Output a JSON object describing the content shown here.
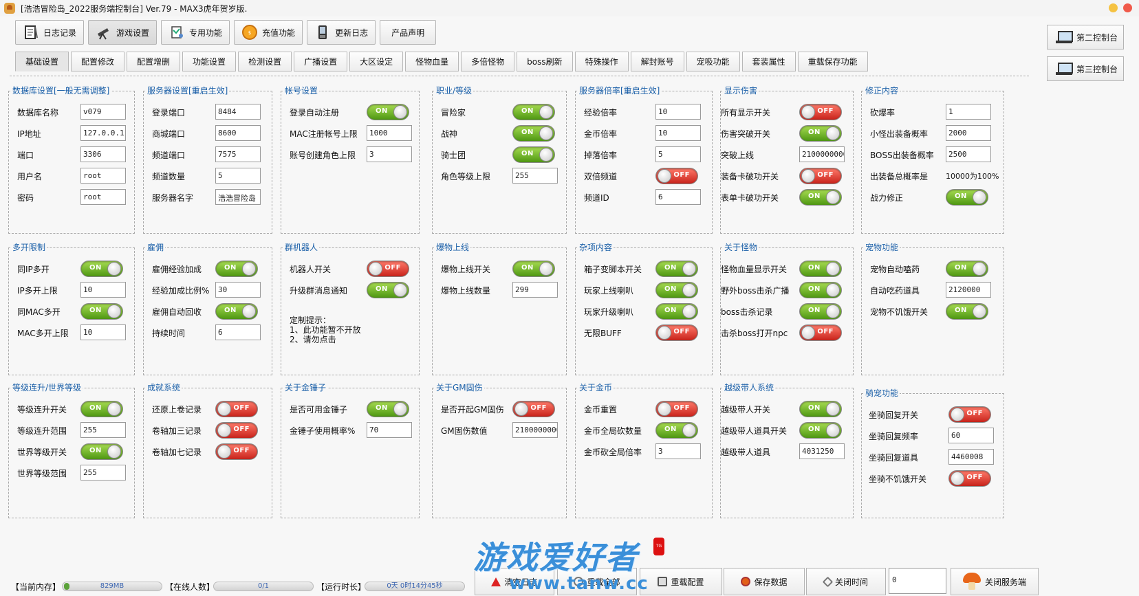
{
  "window": {
    "title": "[浩浩冒险岛_2022服务端控制台] Ver.79 - MAX3虎年贺岁版."
  },
  "main_tabs": [
    {
      "label": "日志记录",
      "icon": "log-icon"
    },
    {
      "label": "游戏设置",
      "icon": "telescope-icon"
    },
    {
      "label": "专用功能",
      "icon": "scroll-icon"
    },
    {
      "label": "充值功能",
      "icon": "coin-icon"
    },
    {
      "label": "更新日志",
      "icon": "phone-icon"
    },
    {
      "label": "产品声明",
      "icon": ""
    }
  ],
  "side_buttons": [
    "第二控制台",
    "第三控制台"
  ],
  "sub_tabs": [
    "基础设置",
    "配置修改",
    "配置增删",
    "功能设置",
    "检测设置",
    "广播设置",
    "大区设定",
    "怪物血量",
    "多倍怪物",
    "boss刷新",
    "特殊操作",
    "解封账号",
    "宠吸功能",
    "套装属性",
    "重载保存功能"
  ],
  "groups": [
    {
      "title": "数据库设置[一般无需调整]",
      "rows": [
        {
          "label": "数据库名称",
          "type": "text",
          "value": "v079"
        },
        {
          "label": "IP地址",
          "type": "text",
          "value": "127.0.0.1"
        },
        {
          "label": "端口",
          "type": "text",
          "value": "3306"
        },
        {
          "label": "用户名",
          "type": "text",
          "value": "root"
        },
        {
          "label": "密码",
          "type": "text",
          "value": "root"
        }
      ]
    },
    {
      "title": "服务器设置[重启生效]",
      "rows": [
        {
          "label": "登录端口",
          "type": "text",
          "value": "8484"
        },
        {
          "label": "商城端口",
          "type": "text",
          "value": "8600"
        },
        {
          "label": "频道端口",
          "type": "text",
          "value": "7575"
        },
        {
          "label": "频道数量",
          "type": "text",
          "value": "5"
        },
        {
          "label": "服务器名字",
          "type": "text",
          "value": "浩浩冒险岛"
        }
      ]
    },
    {
      "title": "帐号设置",
      "rows": [
        {
          "label": "登录自动注册",
          "type": "toggle",
          "value": "ON"
        },
        {
          "label": "MAC注册帐号上限",
          "type": "text",
          "value": "1000"
        },
        {
          "label": "账号创建角色上限",
          "type": "text",
          "value": "3"
        }
      ]
    },
    {
      "title": "职业/等级",
      "rows": [
        {
          "label": "冒险家",
          "type": "toggle",
          "value": "ON"
        },
        {
          "label": "战神",
          "type": "toggle",
          "value": "ON"
        },
        {
          "label": "骑士团",
          "type": "toggle",
          "value": "ON"
        },
        {
          "label": "角色等级上限",
          "type": "text",
          "value": "255"
        }
      ]
    },
    {
      "title": "服务器倍率[重启生效]",
      "rows": [
        {
          "label": "经验倍率",
          "type": "text",
          "value": "10"
        },
        {
          "label": "金币倍率",
          "type": "text",
          "value": "10"
        },
        {
          "label": "掉落倍率",
          "type": "text",
          "value": "5"
        },
        {
          "label": "双倍频道",
          "type": "toggle",
          "value": "OFF"
        },
        {
          "label": "频道ID",
          "type": "text",
          "value": "6"
        }
      ]
    },
    {
      "title": "显示伤害",
      "rows": [
        {
          "label": "所有显示开关",
          "type": "toggle",
          "value": "OFF"
        },
        {
          "label": "伤害突破开关",
          "type": "toggle",
          "value": "ON"
        },
        {
          "label": "突破上线",
          "type": "text",
          "value": "2100000000"
        },
        {
          "label": "装备卡破功开关",
          "type": "toggle",
          "value": "OFF"
        },
        {
          "label": "表单卡破功开关",
          "type": "toggle",
          "value": "ON"
        }
      ]
    },
    {
      "title": "修正内容",
      "rows": [
        {
          "label": "砍爆率",
          "type": "text",
          "value": "1"
        },
        {
          "label": "小怪出装备概率",
          "type": "text",
          "value": "2000"
        },
        {
          "label": "BOSS出装备概率",
          "type": "text",
          "value": "2500"
        },
        {
          "label": "出装备总概率是",
          "type": "static",
          "value": "10000为100%"
        },
        {
          "label": "战力修正",
          "type": "toggle",
          "value": "ON"
        }
      ]
    },
    {
      "title": "多开限制",
      "rows": [
        {
          "label": "同IP多开",
          "type": "toggle",
          "value": "ON"
        },
        {
          "label": "IP多开上限",
          "type": "text",
          "value": "10"
        },
        {
          "label": "同MAC多开",
          "type": "toggle",
          "value": "ON"
        },
        {
          "label": "MAC多开上限",
          "type": "text",
          "value": "10"
        }
      ]
    },
    {
      "title": "雇佣",
      "rows": [
        {
          "label": "雇佣经验加成",
          "type": "toggle",
          "value": "ON"
        },
        {
          "label": "经验加成比例%",
          "type": "text",
          "value": "30"
        },
        {
          "label": "雇佣自动回收",
          "type": "toggle",
          "value": "ON"
        },
        {
          "label": "持续时间",
          "type": "text",
          "value": "6"
        }
      ]
    },
    {
      "title": "群机器人",
      "rows": [
        {
          "label": "机器人开关",
          "type": "toggle",
          "value": "OFF"
        },
        {
          "label": "升级群消息通知",
          "type": "toggle",
          "value": "ON"
        }
      ],
      "note": "定制提示：\n1、此功能暂不开放\n2、请勿点击"
    },
    {
      "title": "爆物上线",
      "rows": [
        {
          "label": "爆物上线开关",
          "type": "toggle",
          "value": "ON"
        },
        {
          "label": "爆物上线数量",
          "type": "text",
          "value": "299"
        }
      ]
    },
    {
      "title": "杂项内容",
      "rows": [
        {
          "label": "箱子变脚本开关",
          "type": "toggle",
          "value": "ON"
        },
        {
          "label": "玩家上线喇叭",
          "type": "toggle",
          "value": "ON"
        },
        {
          "label": "玩家升级喇叭",
          "type": "toggle",
          "value": "ON"
        },
        {
          "label": "无限BUFF",
          "type": "toggle",
          "value": "OFF"
        }
      ]
    },
    {
      "title": "关于怪物",
      "rows": [
        {
          "label": "怪物血量显示开关",
          "type": "toggle",
          "value": "ON"
        },
        {
          "label": "野外boss击杀广播",
          "type": "toggle",
          "value": "ON"
        },
        {
          "label": "boss击杀记录",
          "type": "toggle",
          "value": "ON"
        },
        {
          "label": "击杀boss打开npc",
          "type": "toggle",
          "value": "OFF"
        }
      ]
    },
    {
      "title": "宠物功能",
      "rows": [
        {
          "label": "宠物自动嗑药",
          "type": "toggle",
          "value": "ON"
        },
        {
          "label": "自动吃药道具",
          "type": "text",
          "value": "2120000"
        },
        {
          "label": "宠物不饥饿开关",
          "type": "toggle",
          "value": "ON"
        }
      ]
    },
    {
      "title": "等级连升/世界等级",
      "rows": [
        {
          "label": "等级连升开关",
          "type": "toggle",
          "value": "ON"
        },
        {
          "label": "等级连升范围",
          "type": "text",
          "value": "255"
        },
        {
          "label": "世界等级开关",
          "type": "toggle",
          "value": "ON"
        },
        {
          "label": "世界等级范围",
          "type": "text",
          "value": "255"
        }
      ]
    },
    {
      "title": "成就系统",
      "rows": [
        {
          "label": "还原上卷记录",
          "type": "toggle",
          "value": "OFF"
        },
        {
          "label": "卷轴加三记录",
          "type": "toggle",
          "value": "OFF"
        },
        {
          "label": "卷轴加七记录",
          "type": "toggle",
          "value": "OFF"
        }
      ]
    },
    {
      "title": "关于金锤子",
      "rows": [
        {
          "label": "是否可用金锤子",
          "type": "toggle",
          "value": "ON"
        },
        {
          "label": "金锤子使用概率%",
          "type": "text",
          "value": "70"
        }
      ]
    },
    {
      "title": "关于GM固伤",
      "rows": [
        {
          "label": "是否开起GM固伤",
          "type": "toggle",
          "value": "OFF"
        },
        {
          "label": "GM固伤数值",
          "type": "text",
          "value": "2100000000"
        }
      ]
    },
    {
      "title": "关于金币",
      "rows": [
        {
          "label": "金币重置",
          "type": "toggle",
          "value": "OFF"
        },
        {
          "label": "金币全局砍数量",
          "type": "toggle",
          "value": "ON"
        },
        {
          "label": "金币砍全局倍率",
          "type": "text",
          "value": "3"
        }
      ]
    },
    {
      "title": "越级带人系统",
      "rows": [
        {
          "label": "越级带人开关",
          "type": "toggle",
          "value": "ON"
        },
        {
          "label": "越级带人道具开关",
          "type": "toggle",
          "value": "ON"
        },
        {
          "label": "越级带人道具",
          "type": "text",
          "value": "4031250"
        }
      ]
    },
    {
      "title": "骑宠功能",
      "rows": [
        {
          "label": "坐骑回复开关",
          "type": "toggle",
          "value": "OFF"
        },
        {
          "label": "坐骑回复频率",
          "type": "text",
          "value": "60"
        },
        {
          "label": "坐骑回复道具",
          "type": "text",
          "value": "4460008"
        },
        {
          "label": "坐骑不饥饿开关",
          "type": "toggle",
          "value": "OFF"
        }
      ]
    }
  ],
  "footer": {
    "memory_label": "【当前内存】",
    "memory_value": "829MB",
    "online_label": "【在线人数】",
    "online_value": "0/1",
    "uptime_label": "【运行时长】",
    "uptime_value": "0天 0时14分45秒",
    "buttons": [
      "清空日志",
      "重载全部",
      "重载配置",
      "保存数据",
      "关闭时间"
    ],
    "time_input": "0",
    "shutdown_label": "关闭服务端"
  },
  "watermark": {
    "text": "游戏爱好者",
    "url": "www.tanw.cc",
    "seal": "TG"
  }
}
